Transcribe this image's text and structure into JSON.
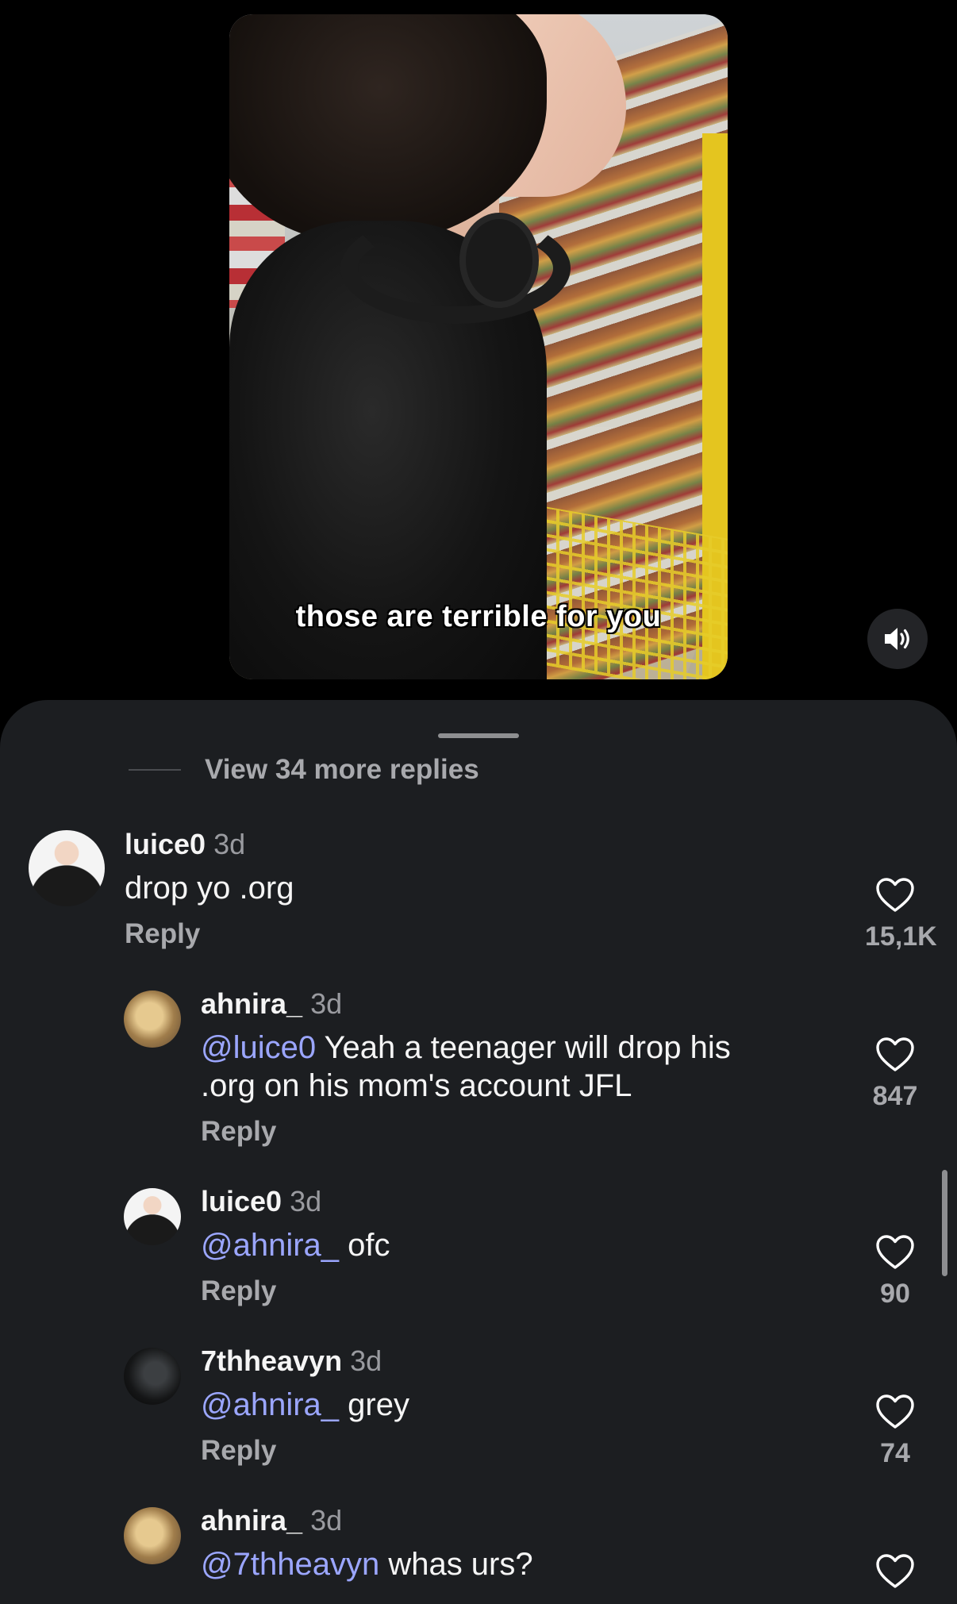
{
  "video": {
    "caption": "those are terrible for you"
  },
  "sheet": {
    "view_more_replies": "View 34 more replies"
  },
  "comments": [
    {
      "user": "luice0",
      "time": "3d",
      "mention": "",
      "text": "drop yo .org",
      "reply_label": "Reply",
      "likes": "15,1K",
      "avatar": "luice0-avatar"
    },
    {
      "user": "ahnira_",
      "time": "3d",
      "mention": "@luice0",
      "text": " Yeah a teenager will drop his .org on his mom's account JFL",
      "reply_label": "Reply",
      "likes": "847",
      "avatar": "ahnira-avatar"
    },
    {
      "user": "luice0",
      "time": "3d",
      "mention": "@ahnira_",
      "text": " ofc",
      "reply_label": "Reply",
      "likes": "90",
      "avatar": "luice0-avatar"
    },
    {
      "user": "7thheavyn",
      "time": "3d",
      "mention": "@ahnira_",
      "text": " grey",
      "reply_label": "Reply",
      "likes": "74",
      "avatar": "7thheavyn-avatar"
    },
    {
      "user": "ahnira_",
      "time": "3d",
      "mention": "@7thheavyn",
      "text": " whas urs?",
      "reply_label": "",
      "likes": "",
      "avatar": "ahnira-avatar"
    }
  ],
  "colors": {
    "background": "#000000",
    "sheet": "#1c1e21",
    "mention": "#9ba6ff",
    "muted": "#a8a9ad"
  },
  "icons": {
    "volume": "speaker-volume-icon",
    "like": "heart-outline-icon"
  }
}
